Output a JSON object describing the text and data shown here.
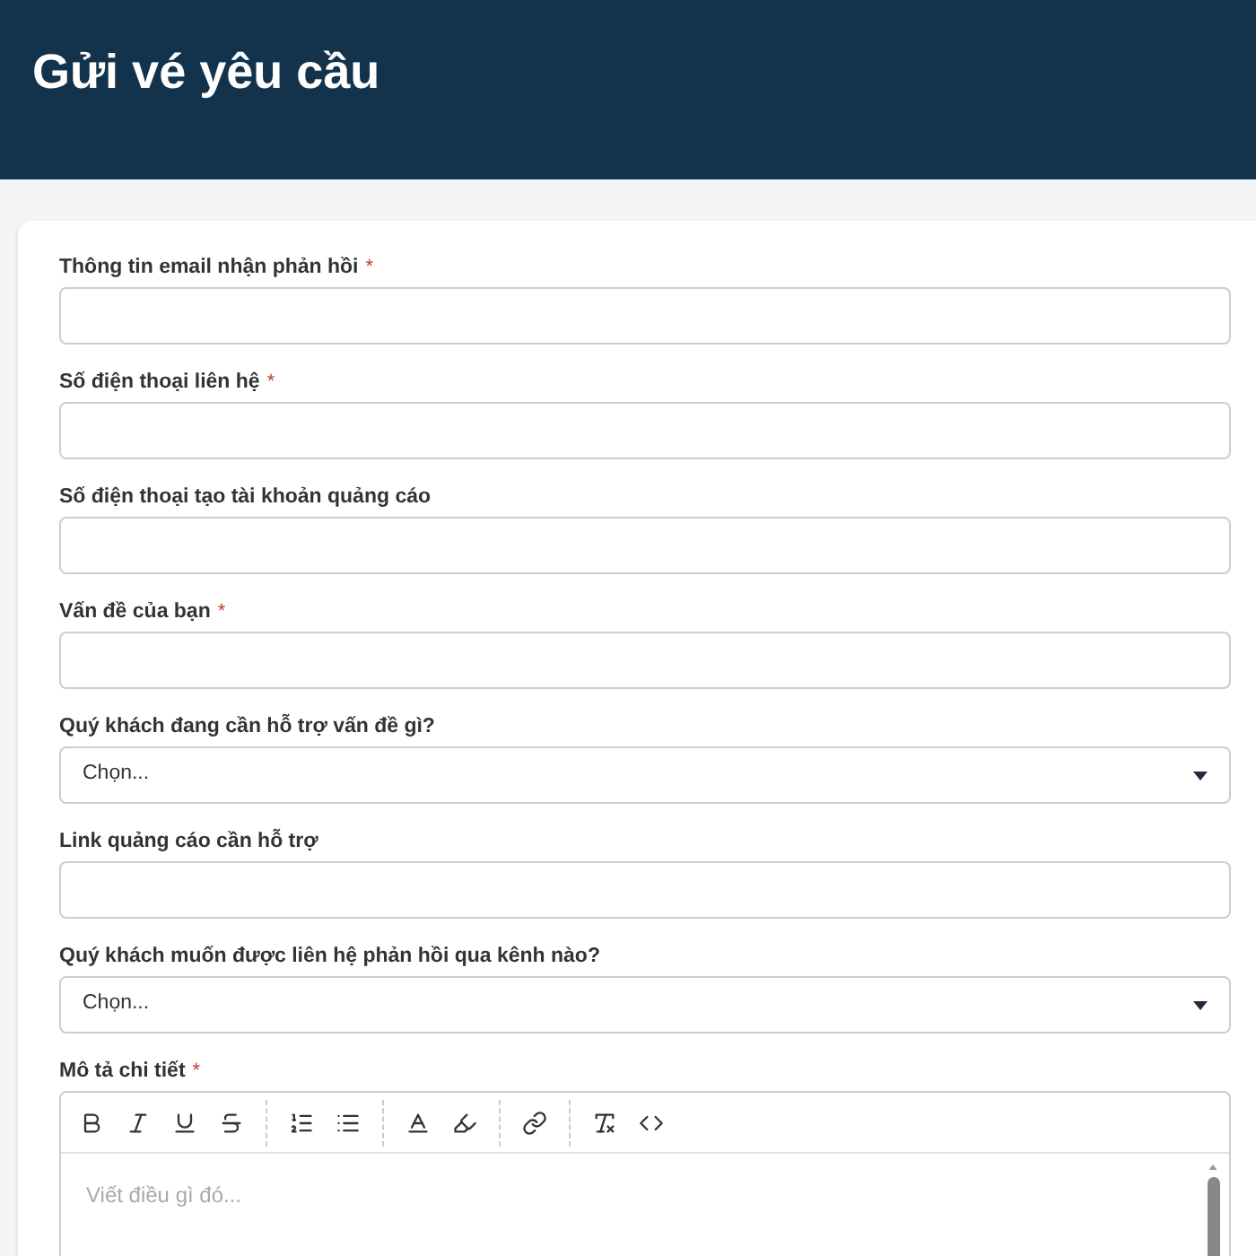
{
  "header": {
    "title": "Gửi vé yêu cầu"
  },
  "fields": [
    {
      "kind": "text",
      "label": "Thông tin email nhận phản hồi",
      "required_mark": "*"
    },
    {
      "kind": "text",
      "label": "Số điện thoại liên hệ",
      "required_mark": "*"
    },
    {
      "kind": "text",
      "label": "Số điện thoại tạo tài khoản quảng cáo"
    },
    {
      "kind": "text",
      "label": "Vấn đề của bạn",
      "required_mark": "*"
    },
    {
      "kind": "select",
      "label": "Quý khách đang cần hỗ trợ vấn đề gì?",
      "placeholder": "Chọn..."
    },
    {
      "kind": "text",
      "label": "Link quảng cáo cần hỗ trợ"
    },
    {
      "kind": "select",
      "label": "Quý khách muốn được liên hệ phản hồi qua kênh nào?",
      "placeholder": "Chọn..."
    }
  ],
  "editor": {
    "label": "Mô tả chi tiết",
    "required_mark": "*",
    "placeholder": "Viết điều gì đó..."
  }
}
